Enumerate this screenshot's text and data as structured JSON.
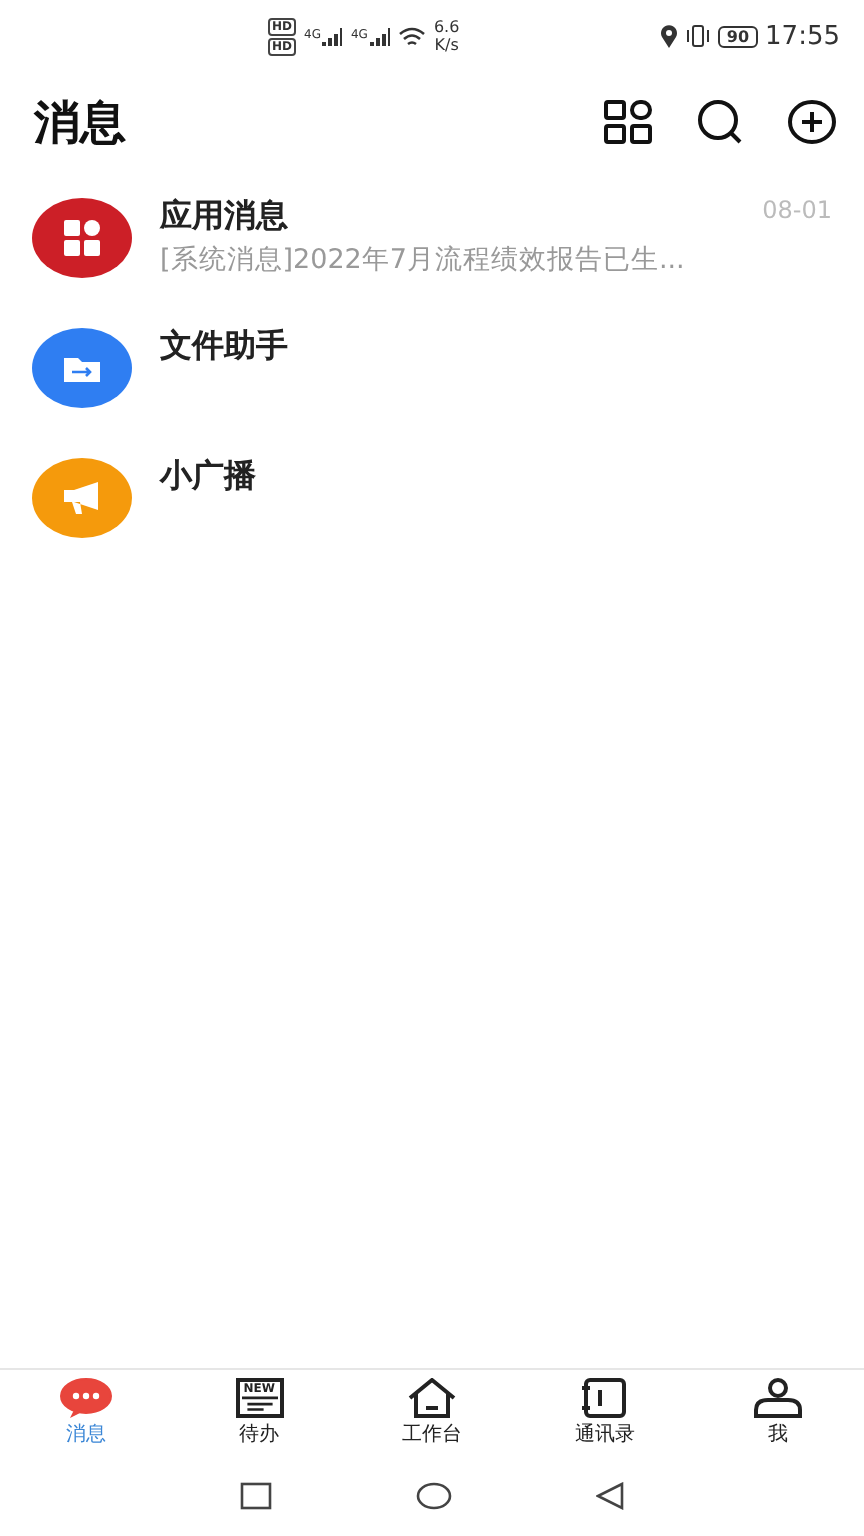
{
  "status_bar": {
    "sim_badges": [
      "HD",
      "HD"
    ],
    "signals": [
      "4G",
      "4G"
    ],
    "speed": "6.6",
    "speed_unit": "K/s",
    "battery": "90",
    "time": "17:55"
  },
  "header": {
    "title": "消息"
  },
  "conversations": [
    {
      "kind": "apps",
      "color": "#cc1f27",
      "name": "应用消息",
      "preview": "[系统消息]2022年7月流程绩效报告已生...",
      "time": "08-01"
    },
    {
      "kind": "folder",
      "color": "#2f7ef2",
      "name": "文件助手"
    },
    {
      "kind": "megaphone",
      "color": "#f59a0c",
      "name": "小广播"
    }
  ],
  "tabs": [
    {
      "kind": "chat",
      "label": "消息",
      "selected": true
    },
    {
      "kind": "todo",
      "label": "待办",
      "icon_text": "NEW",
      "selected": false
    },
    {
      "kind": "home",
      "label": "工作台",
      "selected": false
    },
    {
      "kind": "contacts",
      "label": "通讯录",
      "selected": false
    },
    {
      "kind": "person",
      "label": "我",
      "selected": false
    }
  ]
}
